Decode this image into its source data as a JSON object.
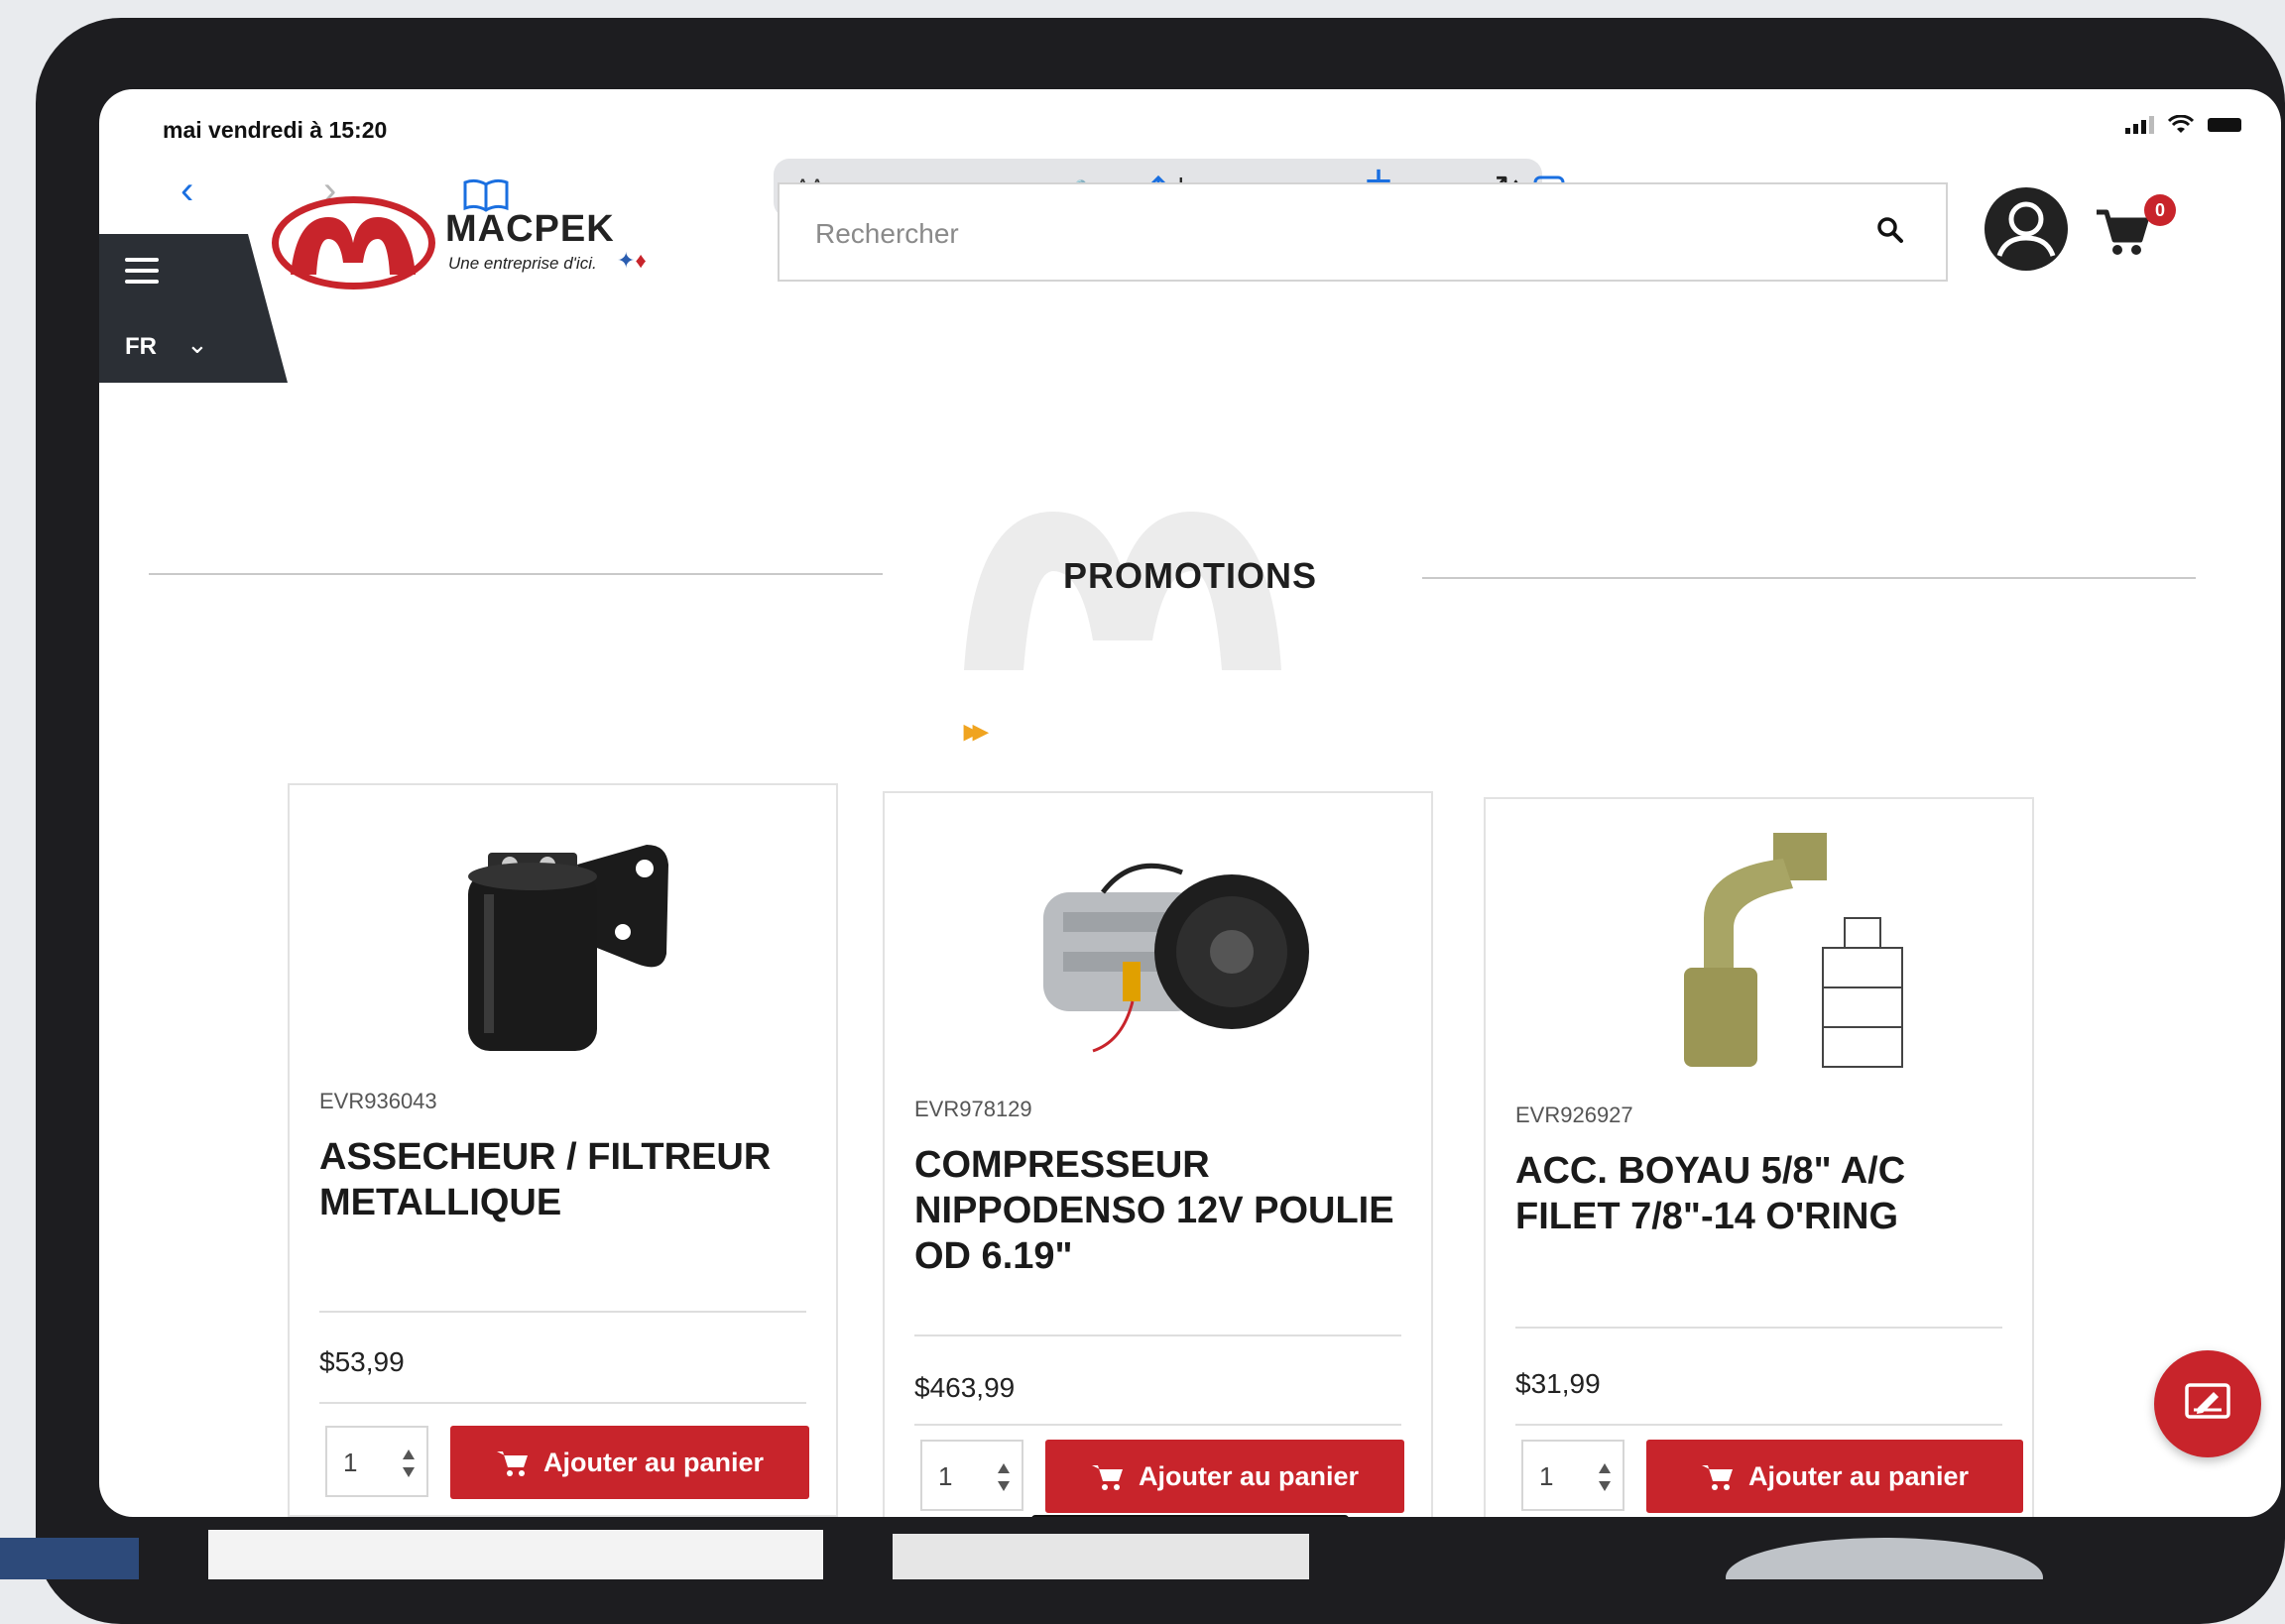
{
  "status_bar": {
    "time": "mai vendredi à 15:20"
  },
  "browser": {
    "text_size": "AA",
    "url": "macpek.com"
  },
  "header": {
    "language": "FR",
    "brand": {
      "name": "MACPEK",
      "tagline": "Une entreprise d'ici."
    },
    "search": {
      "placeholder": "Rechercher",
      "value": ""
    },
    "cart_count": "0"
  },
  "promotions": {
    "title": "PROMOTIONS",
    "products": [
      {
        "sku": "EVR936043",
        "name": "ASSECHEUR / FILTREUR METALLIQUE",
        "price": "$53,99",
        "qty": "1",
        "button": "Ajouter au panier"
      },
      {
        "sku": "EVR978129",
        "name": "COMPRESSEUR NIPPODENSO 12V POULIE OD 6.19\"",
        "price": "$463,99",
        "qty": "1",
        "button": "Ajouter au panier"
      },
      {
        "sku": "EVR926927",
        "name": "ACC. BOYAU 5/8\" A/C FILET 7/8\"-14 O'RING",
        "price": "$31,99",
        "qty": "1",
        "button": "Ajouter au panier"
      }
    ]
  },
  "colors": {
    "brand_red": "#c8242b",
    "dark_panel": "#2b2f35",
    "safari_blue": "#1a6fe0",
    "arrow_orange": "#f0a420"
  }
}
